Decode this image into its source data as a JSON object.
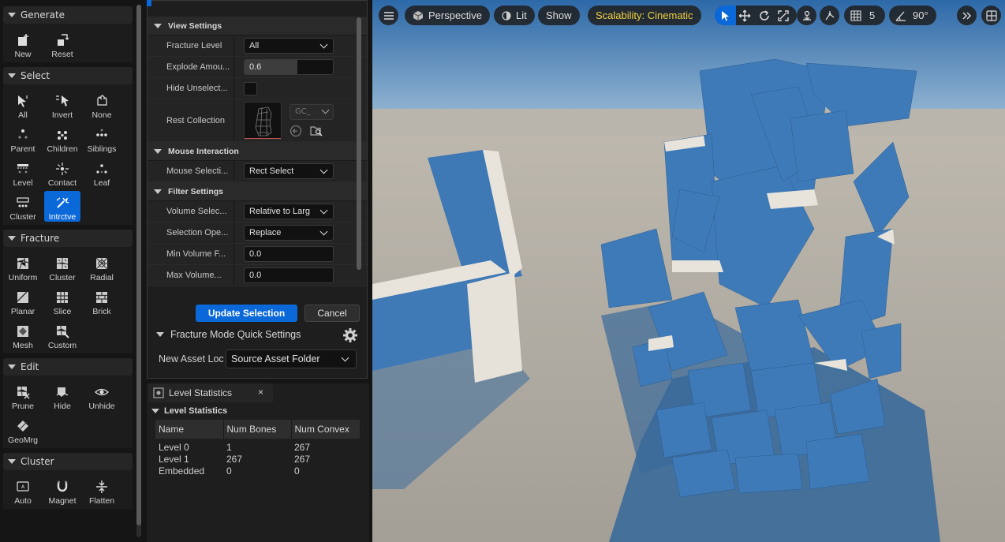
{
  "palette": {
    "sections": [
      {
        "title": "Generate",
        "tools": [
          {
            "label": "New",
            "icon": "new-icon"
          },
          {
            "label": "Reset",
            "icon": "reset-icon"
          }
        ]
      },
      {
        "title": "Select",
        "tools": [
          {
            "label": "All",
            "icon": "select-all-icon"
          },
          {
            "label": "Invert",
            "icon": "invert-icon"
          },
          {
            "label": "None",
            "icon": "select-none-icon"
          },
          {
            "label": "Parent",
            "icon": "parent-icon"
          },
          {
            "label": "Children",
            "icon": "children-icon"
          },
          {
            "label": "Siblings",
            "icon": "siblings-icon"
          },
          {
            "label": "Level",
            "icon": "level-icon"
          },
          {
            "label": "Contact",
            "icon": "contact-icon"
          },
          {
            "label": "Leaf",
            "icon": "leaf-icon"
          },
          {
            "label": "Cluster",
            "icon": "cluster-select-icon"
          },
          {
            "label": "Intrctve",
            "icon": "interactive-icon"
          }
        ]
      },
      {
        "title": "Fracture",
        "tools": [
          {
            "label": "Uniform",
            "icon": "uniform-icon"
          },
          {
            "label": "Cluster",
            "icon": "cluster-fracture-icon"
          },
          {
            "label": "Radial",
            "icon": "radial-icon"
          },
          {
            "label": "Planar",
            "icon": "planar-icon"
          },
          {
            "label": "Slice",
            "icon": "slice-icon"
          },
          {
            "label": "Brick",
            "icon": "brick-icon"
          },
          {
            "label": "Mesh",
            "icon": "mesh-icon"
          },
          {
            "label": "Custom",
            "icon": "custom-icon"
          }
        ]
      },
      {
        "title": "Edit",
        "tools": [
          {
            "label": "Prune",
            "icon": "prune-icon"
          },
          {
            "label": "Hide",
            "icon": "hide-icon"
          },
          {
            "label": "Unhide",
            "icon": "unhide-icon"
          },
          {
            "label": "GeoMrg",
            "icon": "geomerge-icon"
          }
        ]
      },
      {
        "title": "Cluster",
        "tools": [
          {
            "label": "Auto",
            "icon": "auto-icon"
          },
          {
            "label": "Magnet",
            "icon": "magnet-icon"
          },
          {
            "label": "Flatten",
            "icon": "flatten-icon"
          }
        ]
      }
    ]
  },
  "details": {
    "view_settings": "View Settings",
    "fracture_level_label": "Fracture Level",
    "fracture_level_value": "All",
    "explode_label": "Explode Amou...",
    "explode_value": "0.6",
    "explode_fraction": 0.6,
    "hide_unselected_label": "Hide Unselect...",
    "rest_collection_label": "Rest Collection",
    "rest_collection_value": "GC_",
    "mouse_interaction": "Mouse Interaction",
    "mouse_selection_label": "Mouse Selecti...",
    "mouse_selection_value": "Rect Select",
    "filter_settings": "Filter Settings",
    "volume_select_label": "Volume Selec...",
    "volume_select_value": "Relative to Larg",
    "selection_op_label": "Selection Ope...",
    "selection_op_value": "Replace",
    "min_volume_label": "Min Volume F...",
    "min_volume_value": "0.0",
    "max_volume_label": "Max Volume...",
    "max_volume_value": "0.0",
    "update_button": "Update Selection",
    "cancel_button": "Cancel",
    "quick_settings": "Fracture Mode Quick Settings",
    "new_asset_label": "New Asset Loc",
    "new_asset_value": "Source Asset Folder"
  },
  "level_stats": {
    "tab_title": "Level Statistics",
    "close": "×",
    "header": "Level Statistics",
    "columns": [
      "Name",
      "Num Bones",
      "Num Convex"
    ],
    "rows": [
      [
        "Level 0",
        "1",
        "267"
      ],
      [
        "Level 1",
        "267",
        "267"
      ],
      [
        "Embedded",
        "0",
        "0"
      ]
    ]
  },
  "viewport": {
    "perspective": "Perspective",
    "lit": "Lit",
    "show": "Show",
    "scalability": "Scalability: Cinematic",
    "grid_value": "5",
    "angle_value": "90°",
    "accent_color": "#0a68d8",
    "scalability_color": "#f0d040"
  }
}
